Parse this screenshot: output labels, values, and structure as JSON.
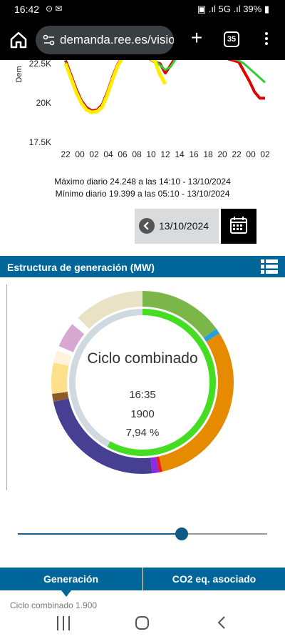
{
  "status_bar": {
    "time": "16:42",
    "battery": "39%",
    "network": "5G"
  },
  "browser": {
    "url": "demanda.ree.es/visio",
    "tab_count": "35"
  },
  "chart_data": {
    "type": "line",
    "ylabel": "Dem",
    "y_ticks": [
      "22.5K",
      "20K",
      "17.5K"
    ],
    "x_ticks": [
      "22",
      "00",
      "02",
      "04",
      "06",
      "08",
      "10",
      "12",
      "14",
      "16",
      "18",
      "20",
      "22",
      "00",
      "02"
    ],
    "series": [
      {
        "color": "#e00000",
        "x": [
          22,
          23,
          24,
          25,
          26,
          27,
          28,
          29,
          30,
          31,
          32,
          33,
          34,
          35,
          36,
          37,
          38,
          39,
          40,
          41,
          42,
          43,
          44,
          45,
          46,
          47,
          48,
          49,
          50,
          51,
          52,
          53,
          54,
          55,
          56,
          57,
          58,
          59,
          60
        ],
        "y": [
          22700,
          21800,
          20900,
          20150,
          19700,
          19500,
          19550,
          19900,
          20700,
          21700,
          22500,
          23000,
          23000,
          23100,
          23050,
          22950,
          22800,
          22600,
          22500,
          21900,
          22400,
          22900,
          23100,
          23200,
          23200,
          23150,
          23100,
          23050,
          23000,
          22950,
          22900,
          22800,
          22700,
          22600,
          22000,
          21400,
          20700,
          20300,
          20300
        ]
      },
      {
        "color": "#33cc33",
        "x": [
          22,
          23,
          24,
          25,
          26,
          27,
          28,
          29,
          30,
          31,
          32,
          33,
          34,
          35,
          36,
          37,
          38,
          39,
          40,
          41,
          42,
          43,
          44,
          45,
          46,
          47,
          48,
          49,
          50,
          51,
          52,
          53,
          54,
          55,
          56,
          57,
          58,
          59,
          60
        ],
        "y": [
          22600,
          21700,
          20800,
          20050,
          19600,
          19450,
          19500,
          19800,
          20600,
          21600,
          22450,
          23000,
          23050,
          23100,
          23050,
          23000,
          22900,
          22700,
          22400,
          22100,
          22300,
          22800,
          23050,
          23150,
          23200,
          23150,
          23100,
          23050,
          23000,
          22950,
          22900,
          22850,
          22800,
          22700,
          22500,
          22200,
          21900,
          21600,
          21300
        ]
      },
      {
        "color": "#ffee00",
        "x": [
          22,
          23,
          24,
          25,
          26,
          27,
          28,
          29,
          30,
          31,
          32,
          33,
          34,
          35,
          36,
          37,
          38,
          39,
          40,
          41,
          42,
          43,
          44,
          45,
          46,
          47,
          48,
          49,
          50,
          51,
          52,
          53,
          54,
          55,
          56,
          57,
          58,
          59,
          60
        ],
        "y": [
          22500,
          21600,
          20700,
          20000,
          19550,
          19400,
          19450,
          19750,
          20550,
          21550,
          22400,
          22950,
          23000,
          23050,
          23000,
          22950,
          22850,
          22650,
          21800,
          21200,
          null,
          null,
          null,
          null,
          null,
          null,
          null,
          null,
          null,
          null,
          null,
          null,
          null,
          null,
          null,
          null,
          null,
          null,
          null
        ]
      }
    ],
    "y_range": [
      17500,
      23500
    ],
    "x_range": [
      21,
      62
    ]
  },
  "stats": {
    "max_line": "Máximo diario 24.248 a las 14:10 - 13/10/2024",
    "min_line": "Mínimo diario 19.399 a las 05:10 - 13/10/2024"
  },
  "date_picker": {
    "date": "13/10/2024"
  },
  "section": {
    "title": "Estructura de generación (MW)"
  },
  "donut": {
    "center_title": "Ciclo combinado",
    "center_time": "16:35",
    "center_value": "1900",
    "center_pct": "7,94 %",
    "outer_segments": [
      {
        "color": "#7ab648",
        "value": 15.0
      },
      {
        "color": "#2a9fd6",
        "value": 1.0
      },
      {
        "color": "#e68a00",
        "value": 30.5
      },
      {
        "color": "#e81e1e",
        "value": 0.6
      },
      {
        "color": "#8b2be2",
        "value": 1.2
      },
      {
        "color": "#463f92",
        "value": 23.3
      },
      {
        "color": "#8b5a2b",
        "value": 1.4
      },
      {
        "color": "#ffe08a",
        "value": 5.5
      },
      {
        "color": "#fff3dc",
        "value": 2.2
      },
      {
        "color": "#ffffff",
        "value": 0.8
      },
      {
        "color": "#d9a8d2",
        "value": 4.5
      },
      {
        "color": "#ffffff",
        "value": 1.5
      },
      {
        "color": "#e9e2c4",
        "value": 12.5
      }
    ],
    "inner_segments": [
      {
        "color": "#44dd22",
        "value": 58
      },
      {
        "color": "#cfd9df",
        "value": 42
      }
    ]
  },
  "slider": {
    "value_fraction": 0.657
  },
  "tabs": [
    {
      "label": "Generación"
    },
    {
      "label": "CO2 eq. asociado"
    }
  ],
  "footer_text": "Ciclo combinado 1.900"
}
